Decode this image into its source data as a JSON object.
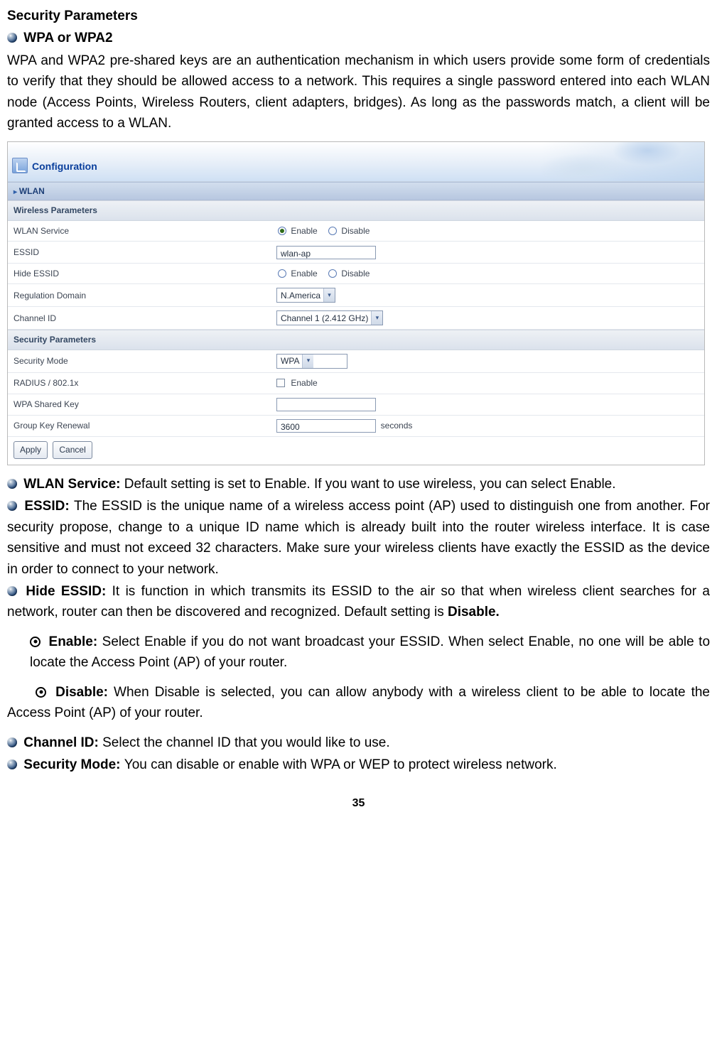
{
  "doc": {
    "h_security_params": "Security Parameters",
    "wpa_or_wpa2": "WPA or WPA2",
    "wpa_para": "WPA and WPA2 pre-shared keys are an authentication mechanism in which users provide some form of credentials to verify that they should be allowed access to a network. This requires a single password entered into each WLAN node (Access Points, Wireless Routers, client adapters, bridges). As long as the passwords match, a client will be granted access to a WLAN.",
    "wlan_service_lbl": "WLAN Service: ",
    "wlan_service_txt": "Default setting is set to Enable. If you want to use wireless, you can select Enable.",
    "essid_lbl": "ESSID: ",
    "essid_txt": "The ESSID is the unique name of a wireless access point (AP) used to distinguish one from another. For security propose, change to a unique ID name which is already built into the router wireless interface. It is case sensitive and must not exceed 32 characters. Make sure your wireless clients have exactly the ESSID as the device in order to connect to your network.",
    "hide_essid_lbl": "Hide ESSID: ",
    "hide_essid_txt_a": "It is function in which transmits its ESSID to the air so that when wireless client searches for a network, router can then be discovered and recognized. Default setting is ",
    "hide_essid_txt_b": "Disable.",
    "enable_lbl": "Enable: ",
    "enable_txt": "Select Enable if you do not want broadcast your ESSID. When select Enable, no one will be able to locate the Access Point (AP) of your router.",
    "disable_lbl": "Disable: ",
    "disable_txt": "When Disable is selected, you can allow anybody with a wireless client to be able to locate the Access Point (AP) of your router.",
    "channel_id_lbl": "Channel ID: ",
    "channel_id_txt": "Select the channel ID that you would like to use.",
    "security_mode_lbl": "Security Mode: ",
    "security_mode_txt": "You can disable or enable with WPA or WEP to protect wireless network.",
    "page_num": "35"
  },
  "ui": {
    "hdr_title": "Configuration",
    "wlan_section": "WLAN",
    "wireless_params": "Wireless Parameters",
    "security_params": "Security Parameters",
    "rows": {
      "wlan_service": "WLAN Service",
      "essid": "ESSID",
      "hide_essid": "Hide ESSID",
      "reg_domain": "Regulation Domain",
      "channel_id": "Channel ID",
      "security_mode": "Security Mode",
      "radius": "RADIUS / 802.1x",
      "wpa_key": "WPA Shared Key",
      "group_key": "Group Key Renewal"
    },
    "opts": {
      "enable": "Enable",
      "disable": "Disable",
      "essid_val": "wlan-ap",
      "reg_domain_val": "N.America",
      "channel_val": "Channel 1 (2.412 GHz)",
      "sec_mode_val": "WPA",
      "radius_enable": "Enable",
      "group_key_val": "3600",
      "seconds": "seconds"
    },
    "btn_apply": "Apply",
    "btn_cancel": "Cancel"
  }
}
